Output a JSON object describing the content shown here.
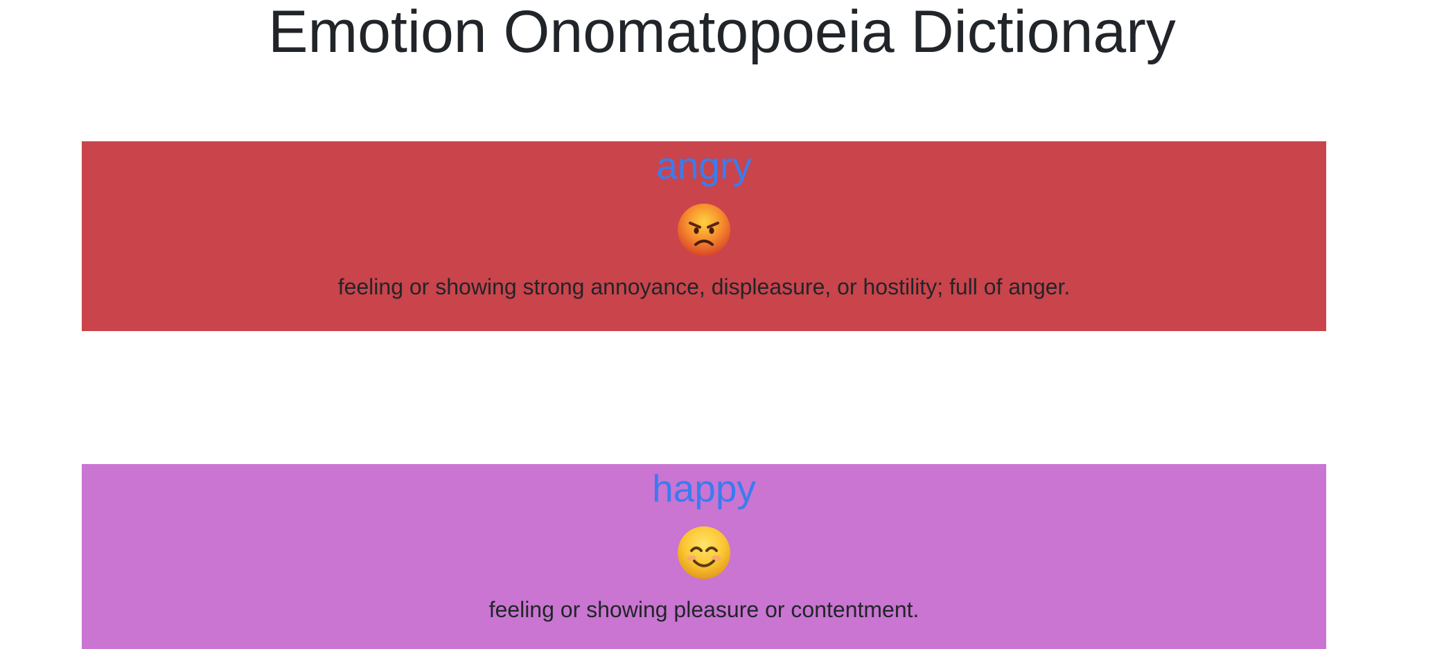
{
  "page": {
    "title": "Emotion Onomatopoeia Dictionary"
  },
  "emotions": [
    {
      "name": "angry",
      "emoji": "angry-face-icon",
      "definition": "feeling or showing strong annoyance, displeasure, or hostility; full of anger.",
      "background_color": "#c9444b"
    },
    {
      "name": "happy",
      "emoji": "smiling-face-icon",
      "definition": "feeling or showing pleasure or contentment.",
      "background_color": "#c975d1"
    }
  ],
  "colors": {
    "link": "#3a7cf0",
    "text": "#212529",
    "page_background": "#ffffff"
  }
}
